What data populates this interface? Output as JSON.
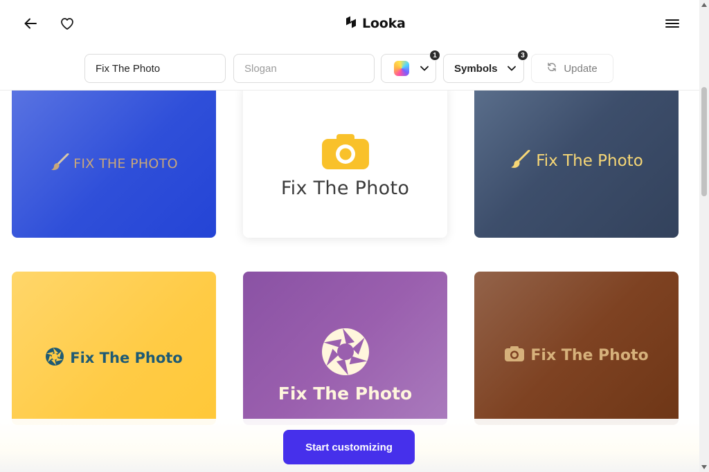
{
  "header": {
    "brand": "Looka",
    "icons": [
      "back-arrow-icon",
      "heart-icon",
      "looka-logo-icon",
      "hamburger-menu-icon"
    ]
  },
  "toolbar": {
    "name_value": "Fix The Photo",
    "slogan_placeholder": "Slogan",
    "colors_badge": "1",
    "symbols_label": "Symbols",
    "symbols_badge": "3",
    "update_label": "Update"
  },
  "logos": [
    {
      "text": "FIX THE PHOTO",
      "bg": "#2f4fd9",
      "text_color": "#c9a77a",
      "icon": "paintbrush-icon"
    },
    {
      "text": "Fix The Photo",
      "bg": "#ffffff",
      "text_color": "#3b3b3b",
      "icon": "camera-icon",
      "icon_color": "#f9c12a"
    },
    {
      "text": "Fix The Photo",
      "bg": "#3d4e6b",
      "text_color": "#f7d776",
      "icon": "paintbrush-icon"
    },
    {
      "text": "Fix The Photo",
      "bg": "#ffcb45",
      "text_color": "#1e5a74",
      "icon": "aperture-icon"
    },
    {
      "text": "Fix The Photo",
      "bg": "#9a5fae",
      "text_color": "#fff6dd",
      "icon": "aperture-icon"
    },
    {
      "text": "Fix The Photo",
      "bg": "#7e4222",
      "text_color": "#d6b17b",
      "icon": "camera-icon"
    }
  ],
  "cta": {
    "label": "Start customizing",
    "color": "#4630eb"
  }
}
